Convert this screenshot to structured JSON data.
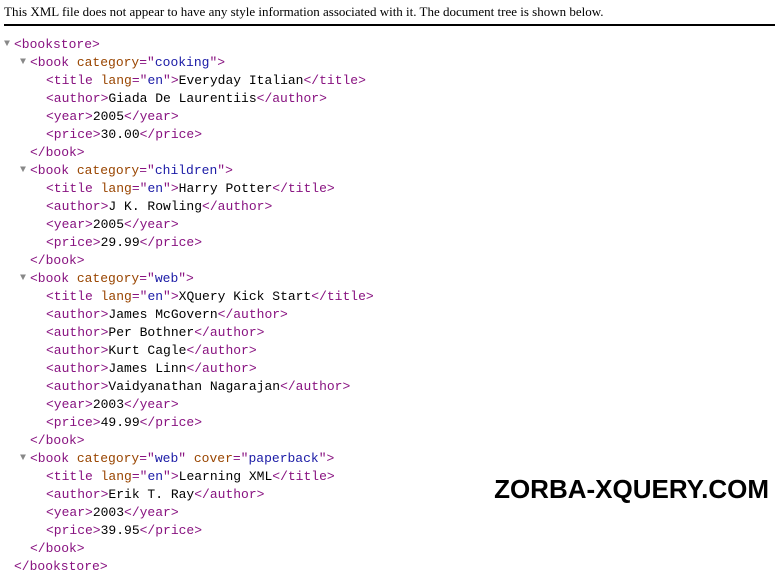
{
  "notice": "This XML file does not appear to have any style information associated with it. The document tree is shown below.",
  "watermark": "ZORBA-XQUERY.COM",
  "triangle": "▼",
  "xml": {
    "root_open": "<bookstore>",
    "root_close": "</bookstore>",
    "books": [
      {
        "open": "<book category=\"cooking\">",
        "open_parts": {
          "p1": "<book ",
          "an1": "category",
          "eq": "=\"",
          "av1": "cooking",
          "p2": "\">"
        },
        "title": {
          "open": "<title ",
          "an": "lang",
          "eq": "=\"",
          "av": "en",
          "close_open": "\">",
          "text": "Everyday Italian",
          "close": "</title>"
        },
        "authors": [
          "Giada De Laurentiis"
        ],
        "year": "2005",
        "price": "30.00",
        "close": "</book>"
      },
      {
        "open_parts": {
          "p1": "<book ",
          "an1": "category",
          "eq": "=\"",
          "av1": "children",
          "p2": "\">"
        },
        "title": {
          "open": "<title ",
          "an": "lang",
          "eq": "=\"",
          "av": "en",
          "close_open": "\">",
          "text": "Harry Potter",
          "close": "</title>"
        },
        "authors": [
          "J K. Rowling"
        ],
        "year": "2005",
        "price": "29.99",
        "close": "</book>"
      },
      {
        "open_parts": {
          "p1": "<book ",
          "an1": "category",
          "eq": "=\"",
          "av1": "web",
          "p2": "\">"
        },
        "title": {
          "open": "<title ",
          "an": "lang",
          "eq": "=\"",
          "av": "en",
          "close_open": "\">",
          "text": "XQuery Kick Start",
          "close": "</title>"
        },
        "authors": [
          "James McGovern",
          "Per Bothner",
          "Kurt Cagle",
          "James Linn",
          "Vaidyanathan Nagarajan"
        ],
        "year": "2003",
        "price": "49.99",
        "close": "</book>"
      },
      {
        "open_parts": {
          "p1": "<book ",
          "an1": "category",
          "eq": "=\"",
          "av1": "web",
          "mid": "\" ",
          "an2": "cover",
          "eq2": "=\"",
          "av2": "paperback",
          "p2": "\">"
        },
        "title": {
          "open": "<title ",
          "an": "lang",
          "eq": "=\"",
          "av": "en",
          "close_open": "\">",
          "text": "Learning XML",
          "close": "</title>"
        },
        "authors": [
          "Erik T. Ray"
        ],
        "year": "2003",
        "price": "39.95",
        "close": "</book>"
      }
    ],
    "tags": {
      "author_open": "<author>",
      "author_close": "</author>",
      "year_open": "<year>",
      "year_close": "</year>",
      "price_open": "<price>",
      "price_close": "</price>"
    }
  }
}
